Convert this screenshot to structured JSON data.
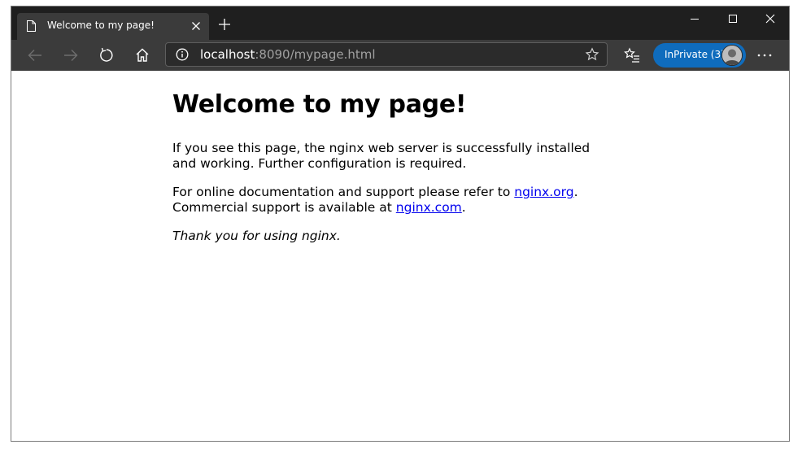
{
  "browser": {
    "tab_title": "Welcome to my page!",
    "url_host": "localhost",
    "url_rest": ":8090/mypage.html",
    "inprivate_label": "InPrivate (3)"
  },
  "page": {
    "heading": "Welcome to my page!",
    "para1": "If you see this page, the nginx web server is successfully installed and working. Further configuration is required.",
    "para2_prefix": "For online documentation and support please refer to ",
    "link_org": "nginx.org",
    "para2_mid": ".",
    "para2_line2": "Commercial support is available at ",
    "link_com": "nginx.com",
    "para2_end": ".",
    "thanks": "Thank you for using nginx."
  },
  "colors": {
    "titlebar": "#1f1f1f",
    "toolbar": "#3b3b3b",
    "inprivate": "#0f6cbd",
    "link": "#0000ee"
  }
}
